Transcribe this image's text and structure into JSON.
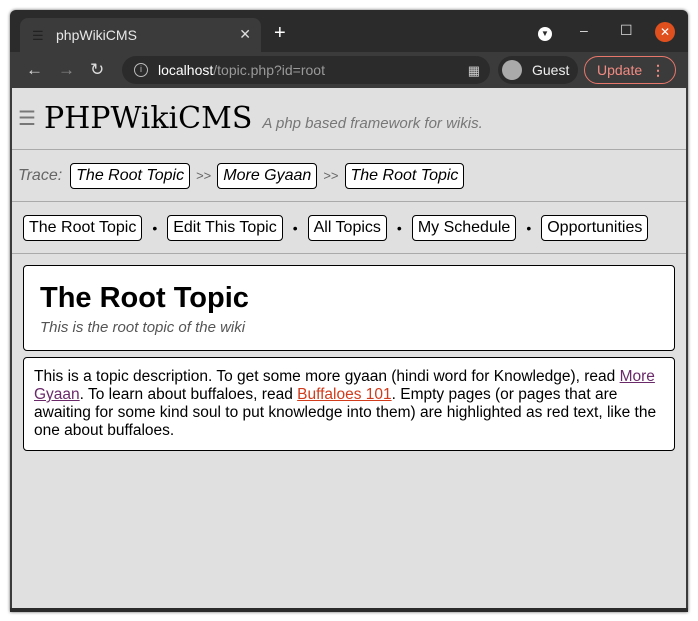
{
  "browser": {
    "tab_title": "phpWikiCMS",
    "url_host": "localhost",
    "url_path": "/topic.php?id=root",
    "profile": "Guest",
    "update_label": "Update"
  },
  "site": {
    "title": "PHPWikiCMS",
    "tagline": "A php based framework for wikis."
  },
  "trace": {
    "label": "Trace:",
    "separator": ">>",
    "items": [
      "The Root Topic",
      "More Gyaan",
      "The Root Topic"
    ]
  },
  "menu": {
    "items": [
      "The Root Topic",
      "Edit This Topic",
      "All Topics",
      "My Schedule",
      "Opportunities"
    ]
  },
  "topic": {
    "title": "The Root Topic",
    "subtitle": "This is the root topic of the wiki",
    "desc_1": "This is a topic description. To get some more gyaan (hindi word for Knowledge), read ",
    "link_1": "More Gyaan",
    "desc_2": ". To learn about buffaloes, read ",
    "link_2": "Buffaloes 101",
    "desc_3": ". Empty pages (or pages that are awaiting for some kind soul to put knowledge into them) are highlighted as red text, like the one about buffaloes."
  }
}
